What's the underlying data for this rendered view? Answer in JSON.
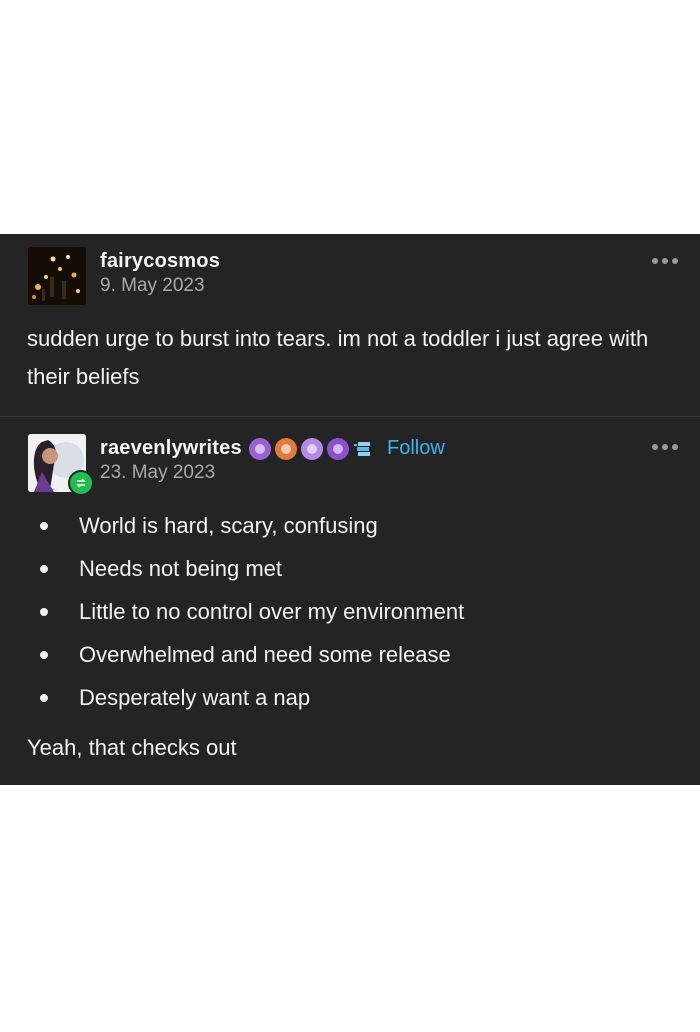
{
  "posts": [
    {
      "username": "fairycosmos",
      "date": "9. May 2023",
      "body": "sudden urge to burst into tears. im not a toddler i just agree with their beliefs"
    },
    {
      "username": "raevenlywrites",
      "date": "23. May 2023",
      "follow_label": "Follow",
      "badges": [
        "purple-cake-icon",
        "pink-bear-icon",
        "lavender-monster-icon",
        "purple-skull-icon",
        "blue-paper-icon"
      ],
      "list_items": [
        "World is hard, scary, confusing",
        "Needs not being met",
        "Little to no control over my environment",
        "Overwhelmed and need some release",
        "Desperately want a nap"
      ],
      "closing": "Yeah, that checks out"
    }
  ],
  "colors": {
    "card_background": "#242424",
    "follow_link": "#39b3f0",
    "reblog_badge": "#1fbf4f",
    "date_text": "#a9a9a9"
  }
}
